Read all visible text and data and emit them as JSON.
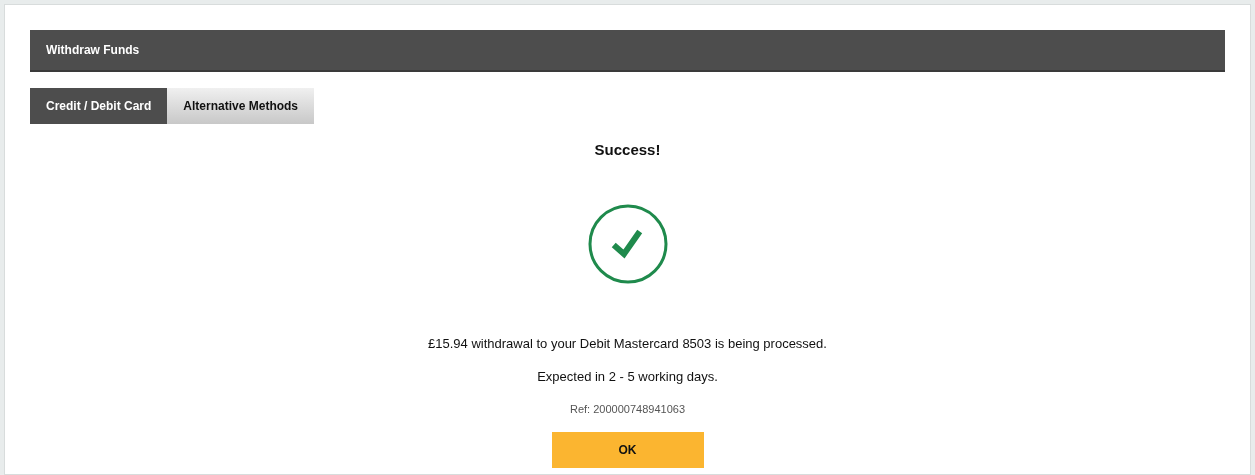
{
  "panel": {
    "title": "Withdraw Funds"
  },
  "tabs": [
    {
      "label": "Credit / Debit Card",
      "selected": true
    },
    {
      "label": "Alternative Methods",
      "selected": false
    }
  ],
  "result": {
    "heading": "Success!",
    "message": "£15.94 withdrawal to your Debit Mastercard 8503 is being processed.",
    "expected": "Expected in 2 - 5 working days.",
    "reference": "Ref: 200000748941063"
  },
  "button": {
    "label": "OK"
  }
}
